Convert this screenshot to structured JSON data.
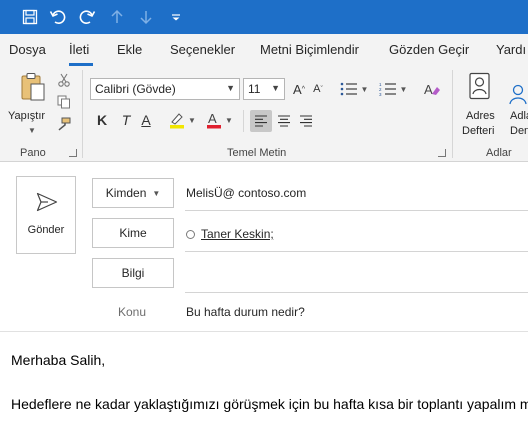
{
  "titlebar": {
    "bg_color": "#1e6fc8",
    "icons": [
      "save-icon",
      "undo-icon",
      "redo-icon",
      "arrow-up-icon",
      "arrow-down-icon",
      "customize-quick-access-icon"
    ]
  },
  "tabs": [
    {
      "label": "Dosya"
    },
    {
      "label": "İleti",
      "active": true
    },
    {
      "label": "Ekle"
    },
    {
      "label": "Seçenekler"
    },
    {
      "label": "Metni Biçimlendir"
    },
    {
      "label": "Gözden Geçir"
    },
    {
      "label": "Yardı"
    }
  ],
  "ribbon": {
    "clipboard": {
      "paste_label": "Yapıştır",
      "group_label": "Pano"
    },
    "basic_text": {
      "font_name": "Calibri (Gövde)",
      "font_size": "11",
      "bold": "K",
      "italic": "T",
      "underline": "A",
      "group_label": "Temel Metin"
    },
    "names": {
      "address_book_line1": "Adres",
      "address_book_line2": "Defteri",
      "check_names_line1": "Adla",
      "check_names_line2": "Dene",
      "group_label": "Adlar"
    }
  },
  "compose": {
    "send_label": "Gönder",
    "from_label": "Kimden",
    "from_value": "MelisÜ@ contoso.com",
    "to_label": "Kime",
    "to_recipient": "Taner Keskin;",
    "cc_label": "Bilgi",
    "subject_label": "Konu",
    "subject_value": "Bu hafta durum nedir?",
    "body_lines": [
      "Merhaba Salih,",
      "Hedeflere ne kadar yaklaştığımızı görüşmek için bu hafta kısa bir toplantı yapalım mı?"
    ]
  }
}
